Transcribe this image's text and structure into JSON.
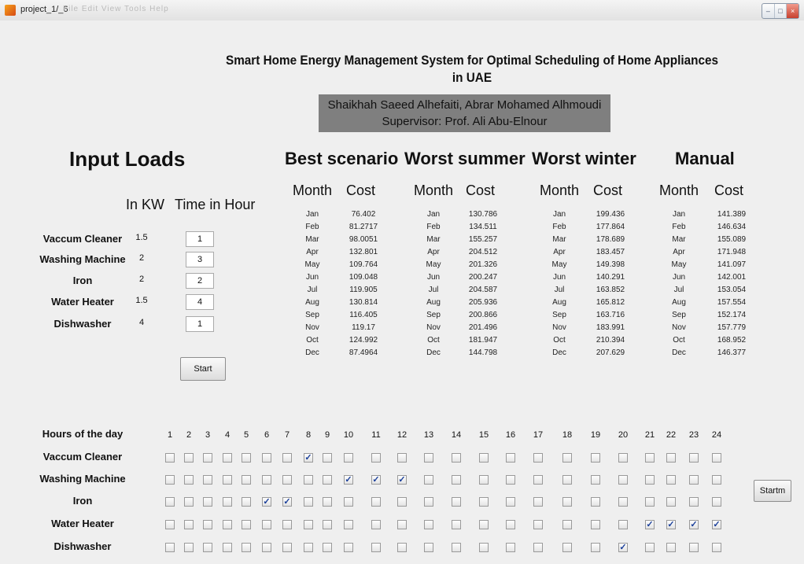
{
  "window": {
    "title": "project_1/_6",
    "menu_blur": "File  Edit  View  Tools  Help"
  },
  "header": {
    "title_line1": "Smart Home Energy Management System for Optimal Scheduling of Home Appliances",
    "title_line2": "in UAE",
    "authors": "Shaikhah Saeed Alhefaiti, Abrar Mohamed Alhmoudi",
    "supervisor": "Supervisor: Prof. Ali Abu-Elnour"
  },
  "input": {
    "heading": "Input Loads",
    "kw_header": "In KW",
    "time_header": "Time in Hour",
    "appliances": [
      {
        "name": "Vaccum Cleaner",
        "kw": "1.5",
        "hours": "1"
      },
      {
        "name": "Washing Machine",
        "kw": "2",
        "hours": "3"
      },
      {
        "name": "Iron",
        "kw": "2",
        "hours": "2"
      },
      {
        "name": "Water Heater",
        "kw": "1.5",
        "hours": "4"
      },
      {
        "name": "Dishwasher",
        "kw": "4",
        "hours": "1"
      }
    ],
    "start_label": "Start"
  },
  "scenarios": [
    {
      "title": "Best scenario",
      "month_header": "Month",
      "cost_header": "Cost",
      "months": [
        "Jan",
        "Feb",
        "Mar",
        "Apr",
        "May",
        "Jun",
        "Jul",
        "Aug",
        "Sep",
        "Nov",
        "Oct",
        "Dec"
      ],
      "costs": [
        "76.402",
        "81.2717",
        "98.0051",
        "132.801",
        "109.764",
        "109.048",
        "119.905",
        "130.814",
        "116.405",
        "119.17",
        "124.992",
        "87.4964"
      ]
    },
    {
      "title": "Worst summer",
      "month_header": "Month",
      "cost_header": "Cost",
      "months": [
        "Jan",
        "Feb",
        "Mar",
        "Apr",
        "May",
        "Jun",
        "Jul",
        "Aug",
        "Sep",
        "Nov",
        "Oct",
        "Dec"
      ],
      "costs": [
        "130.786",
        "134.511",
        "155.257",
        "204.512",
        "201.326",
        "200.247",
        "204.587",
        "205.936",
        "200.866",
        "201.496",
        "181.947",
        "144.798"
      ]
    },
    {
      "title": "Worst winter",
      "month_header": "Month",
      "cost_header": "Cost",
      "months": [
        "Jan",
        "Feb",
        "Mar",
        "Apr",
        "May",
        "Jun",
        "Jul",
        "Aug",
        "Sep",
        "Nov",
        "Oct",
        "Dec"
      ],
      "costs": [
        "199.436",
        "177.864",
        "178.689",
        "183.457",
        "149.398",
        "140.291",
        "163.852",
        "165.812",
        "163.716",
        "183.991",
        "210.394",
        "207.629"
      ]
    },
    {
      "title": "Manual",
      "month_header": "Month",
      "cost_header": "Cost",
      "months": [
        "Jan",
        "Feb",
        "Mar",
        "Apr",
        "May",
        "Jun",
        "Jul",
        "Aug",
        "Sep",
        "Nov",
        "Oct",
        "Dec"
      ],
      "costs": [
        "141.389",
        "146.634",
        "155.089",
        "171.948",
        "141.097",
        "142.001",
        "153.054",
        "157.554",
        "152.174",
        "157.779",
        "168.952",
        "146.377"
      ]
    }
  ],
  "schedule": {
    "hours_label": "Hours of the day",
    "hours": [
      "1",
      "2",
      "3",
      "4",
      "5",
      "6",
      "7",
      "8",
      "9",
      "10",
      "11",
      "12",
      "13",
      "14",
      "15",
      "16",
      "17",
      "18",
      "19",
      "20",
      "21",
      "22",
      "23",
      "24"
    ],
    "rows": [
      {
        "name": "Vaccum Cleaner",
        "checked": [
          8
        ]
      },
      {
        "name": "Washing Machine",
        "checked": [
          10,
          11,
          12
        ]
      },
      {
        "name": "Iron",
        "checked": [
          6,
          7
        ]
      },
      {
        "name": "Water Heater",
        "checked": [
          21,
          22,
          23,
          24
        ]
      },
      {
        "name": "Dishwasher",
        "checked": [
          20
        ]
      }
    ],
    "manual_start_label": "Startm"
  }
}
